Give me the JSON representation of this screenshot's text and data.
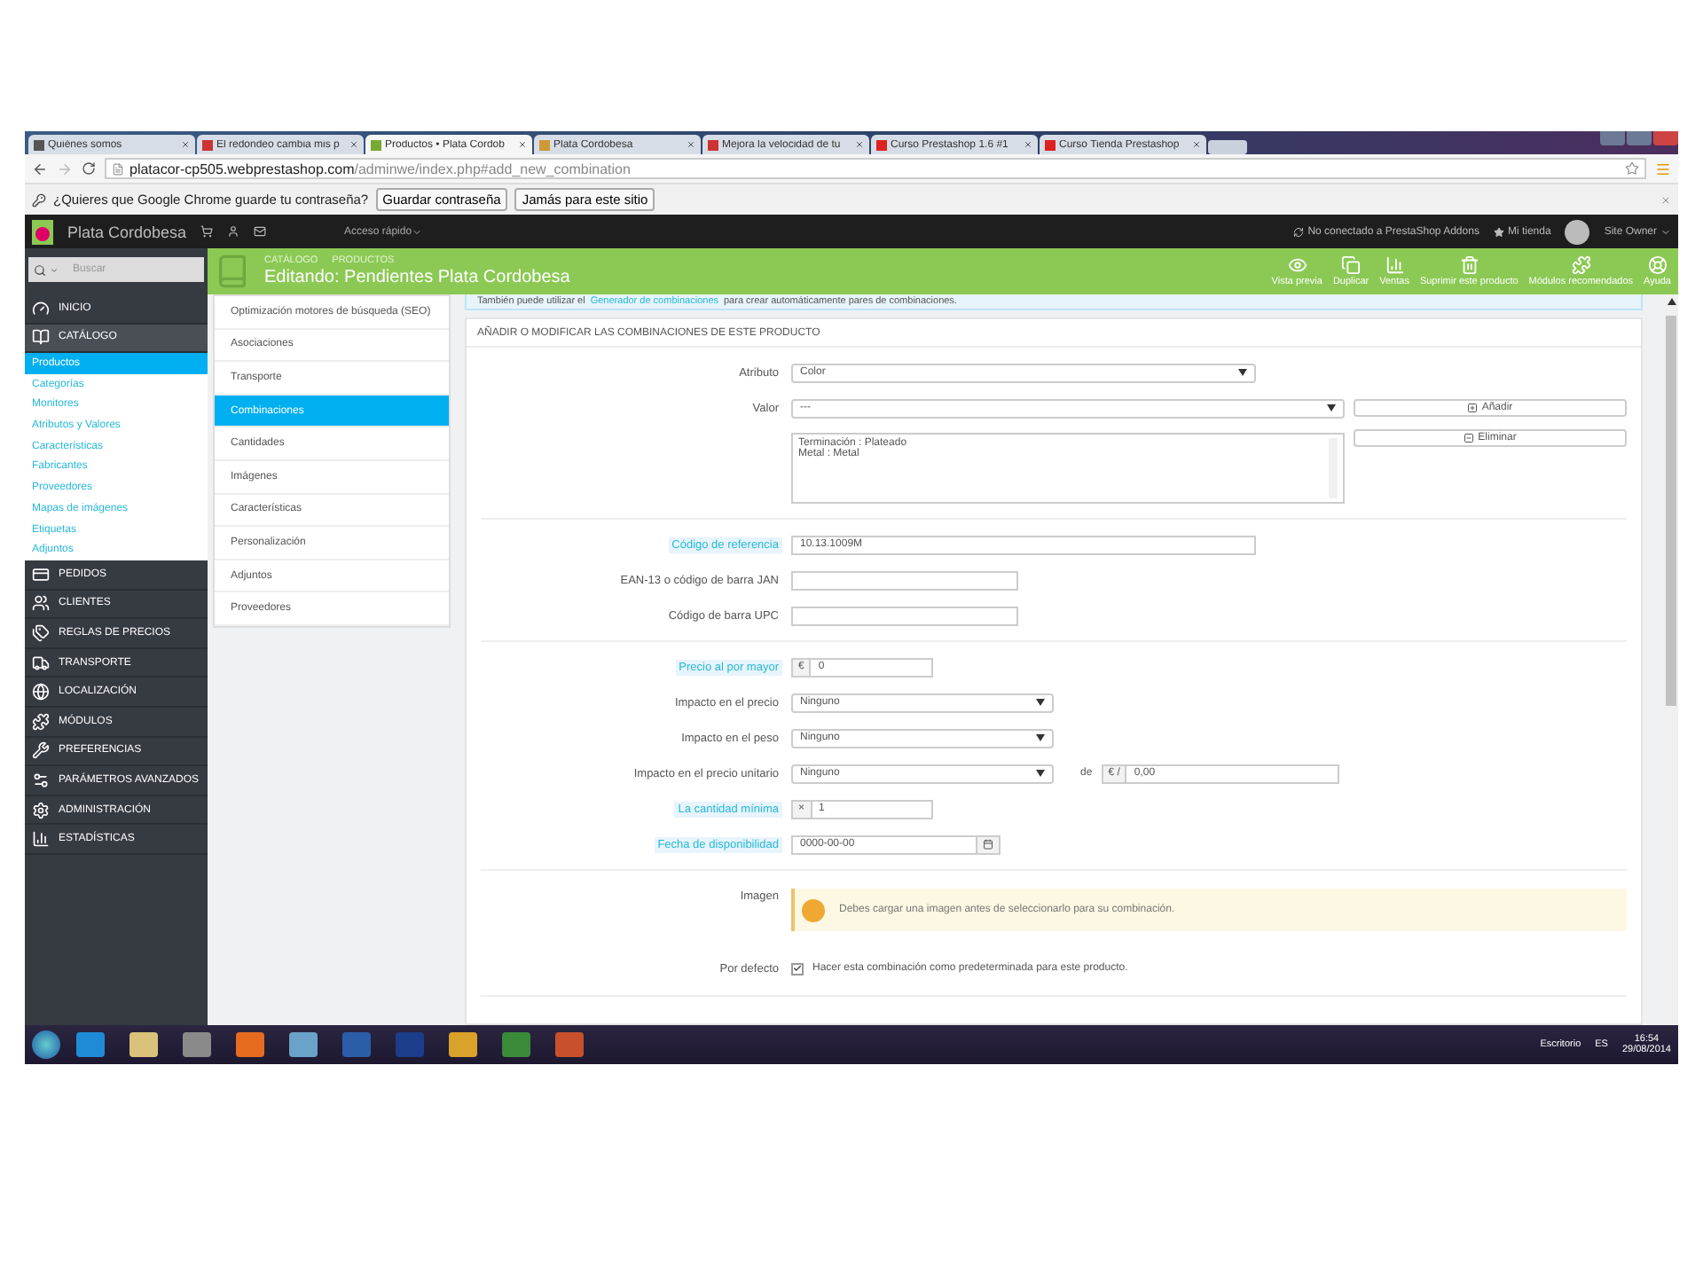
{
  "browser": {
    "tabs": [
      {
        "label": "Quiénes somos",
        "selected": false
      },
      {
        "label": "El redondeo cambia mis p",
        "selected": false
      },
      {
        "label": "Productos • Plata Cordob",
        "selected": true
      },
      {
        "label": "Plata Cordobesa",
        "selected": false
      },
      {
        "label": "Mejora la velocidad de tu",
        "selected": false
      },
      {
        "label": "Curso Prestashop 1.6 #1",
        "selected": false
      },
      {
        "label": "Curso Tienda Prestashop",
        "selected": false
      }
    ],
    "url_host": "platacor-cp505.webprestashop.com",
    "url_path": "/adminwe/index.php#add_new_combination",
    "password_bar": {
      "message": "¿Quieres que Google Chrome guarde tu contraseña?",
      "buttons": [
        "Guardar contraseña",
        "Jamás para este sitio"
      ]
    }
  },
  "admin_bar": {
    "shop": "Plata Cordobesa",
    "quick_access": "Acceso rápido",
    "addons": "No conectado a PrestaShop Addons",
    "my_shop": "Mi tienda",
    "user": "Site Owner"
  },
  "sidebar": {
    "search": {
      "placeholder": "Buscar"
    },
    "items": [
      {
        "label": "INICIO",
        "selected": false
      },
      {
        "label": "CATÁLOGO",
        "selected": true,
        "expanded": true,
        "children": [
          {
            "label": "Productos",
            "selected": true
          },
          {
            "label": "Categorías",
            "selected": false
          },
          {
            "label": "Monitores",
            "selected": false
          },
          {
            "label": "Atributos y Valores",
            "selected": false
          },
          {
            "label": "Características",
            "selected": false
          },
          {
            "label": "Fabricantes",
            "selected": false
          },
          {
            "label": "Proveedores",
            "selected": false
          },
          {
            "label": "Mapas de imágenes",
            "selected": false
          },
          {
            "label": "Etiquetas",
            "selected": false
          },
          {
            "label": "Adjuntos",
            "selected": false
          }
        ]
      },
      {
        "label": "PEDIDOS",
        "selected": false
      },
      {
        "label": "CLIENTES",
        "selected": false
      },
      {
        "label": "REGLAS DE PRECIOS",
        "selected": false
      },
      {
        "label": "TRANSPORTE",
        "selected": false
      },
      {
        "label": "LOCALIZACIÓN",
        "selected": false
      },
      {
        "label": "MÓDULOS",
        "selected": false
      },
      {
        "label": "PREFERENCIAS",
        "selected": false
      },
      {
        "label": "PARÁMETROS AVANZADOS",
        "selected": false
      },
      {
        "label": "ADMINISTRACIÓN",
        "selected": false
      },
      {
        "label": "ESTADÍSTICAS",
        "selected": false
      }
    ]
  },
  "header": {
    "breadcrumb": [
      "CATÁLOGO",
      "PRODUCTOS"
    ],
    "title": "Editando: Pendientes Plata Cordobesa",
    "actions": [
      "Vista previa",
      "Duplicar",
      "Ventas",
      "Suprimir este producto",
      "Módulos recomendados",
      "Ayuda"
    ]
  },
  "product_tabs": [
    {
      "label": "Optimización motores de búsqueda (SEO)",
      "selected": false
    },
    {
      "label": "Asociaciones",
      "selected": false
    },
    {
      "label": "Transporte",
      "selected": false
    },
    {
      "label": "Combinaciones",
      "selected": true
    },
    {
      "label": "Cantidades",
      "selected": false
    },
    {
      "label": "Imágenes",
      "selected": false
    },
    {
      "label": "Características",
      "selected": false
    },
    {
      "label": "Personalización",
      "selected": false
    },
    {
      "label": "Adjuntos",
      "selected": false
    },
    {
      "label": "Proveedores",
      "selected": false
    }
  ],
  "info_banner": {
    "before": "También puede utilizar el",
    "link": "Generador de combinaciones",
    "after": "para crear automáticamente pares de combinaciones."
  },
  "form": {
    "title": "AÑADIR O MODIFICAR LAS COMBINACIONES DE ESTE PRODUCTO",
    "sections": [
      {
        "rows": [
          {
            "kind": "select",
            "label": "Atributo",
            "hint": false,
            "value": "Color"
          },
          {
            "kind": "select",
            "label": "Valor",
            "hint": false,
            "value": "---",
            "button": "Añadir"
          },
          {
            "kind": "listbox",
            "items": [
              "Terminación : Plateado",
              "Metal : Metal"
            ],
            "button": "Eliminar"
          }
        ]
      },
      {
        "rows": [
          {
            "kind": "input",
            "label": "Código de referencia",
            "hint": true,
            "value": "10.13.1009M"
          },
          {
            "kind": "input",
            "label": "EAN-13 o código de barra JAN",
            "hint": false
          },
          {
            "kind": "input",
            "label": "Código de barra UPC",
            "hint": false
          }
        ]
      },
      {
        "rows": [
          {
            "kind": "prefixed",
            "label": "Precio al por mayor",
            "hint": true,
            "prefix": "€",
            "value": "0"
          },
          {
            "kind": "select",
            "label": "Impacto en el precio",
            "hint": false,
            "value": "Ninguno"
          },
          {
            "kind": "select",
            "label": "Impacto en el peso",
            "hint": false,
            "value": "Ninguno"
          },
          {
            "kind": "select",
            "label": "Impacto en el precio unitario",
            "hint": false,
            "value": "Ninguno",
            "extra": {
              "label": "de",
              "prefix": "€ /",
              "value": "0,00"
            }
          },
          {
            "kind": "prefixed",
            "label": "La cantidad mínima",
            "hint": true,
            "prefix": "×",
            "value": "1"
          },
          {
            "kind": "date",
            "label": "Fecha de disponibilidad",
            "hint": true,
            "value": "0000-00-00"
          }
        ]
      },
      {
        "rows": [
          {
            "kind": "alert",
            "label": "Imagen",
            "text": "Debes cargar una imagen antes de seleccionarlo para su combinación."
          },
          {
            "kind": "checkbox",
            "label": "Por defecto",
            "checked": true,
            "text": "Hacer esta combinación como predeterminada para este producto."
          }
        ]
      }
    ]
  },
  "taskbar": {
    "desktop": "Escritorio",
    "language": "ES",
    "time": "16:54",
    "date": "29/08/2014"
  }
}
